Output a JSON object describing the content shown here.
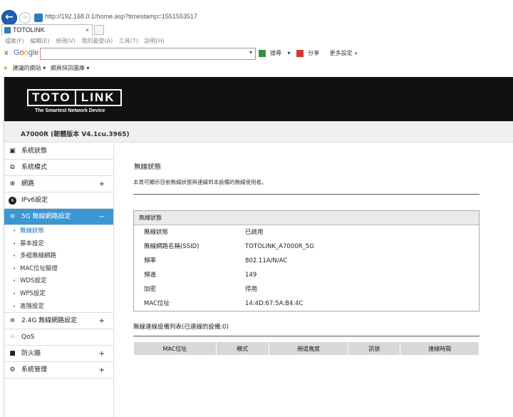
{
  "browser": {
    "url": "http://192.168.0.1/home.asp?timestamp=1551553517",
    "tab_title": "TOTOLINK",
    "tab_close": "×",
    "back": "←",
    "forward": "→"
  },
  "menu": [
    "檔案(F)",
    "編輯(E)",
    "檢視(V)",
    "我的最愛(A)",
    "工具(T)",
    "說明(H)"
  ],
  "google_toolbar": {
    "close": "x",
    "logo": "Google",
    "search_label": "搜尋",
    "share_label": "分享",
    "more_label": "更多設定 »"
  },
  "favorites": {
    "item1": "建議的網站 ▾",
    "item2": "網頁快訊圖庫 ▾"
  },
  "router": {
    "logo_left": "TOTO",
    "logo_right": "LINK",
    "tagline": "The Smartest Network Device",
    "model": "A7000R (韌體版本 V4.1cu.3965)"
  },
  "nav": [
    {
      "label": "系統狀態",
      "icon": "▣"
    },
    {
      "label": "系統模式",
      "icon": "⧉"
    },
    {
      "label": "網路",
      "icon": "⊕",
      "expand": "+"
    },
    {
      "label": "IPv6設定",
      "icon": "6"
    },
    {
      "label": "5G 無線網路設定",
      "icon": "≋",
      "expand": "−"
    },
    {
      "label": "2.4G 無線網路設定",
      "icon": "≋",
      "expand": "+"
    },
    {
      "label": "QoS",
      "icon": "⁘"
    },
    {
      "label": "防火牆",
      "icon": "■",
      "expand": "+"
    },
    {
      "label": "系統管理",
      "icon": "⚙",
      "expand": "+"
    }
  ],
  "subnav": [
    "無線狀態",
    "基本設定",
    "多組無線網路",
    "MAC位址驗證",
    "WDS設定",
    "WPS設定",
    "進階設定"
  ],
  "content": {
    "title": "無線狀態",
    "description": "本頁可顯示目前無線狀態與連線到本設備的無線使用者。",
    "status_header": "無線狀態",
    "rows": [
      {
        "key": "無線狀態",
        "value": "已啟用"
      },
      {
        "key": "無線網路名稱(SSID)",
        "value": "TOTOLINK_A7000R_5G"
      },
      {
        "key": "頻率",
        "value": "802.11A/N/AC"
      },
      {
        "key": "頻道",
        "value": "149"
      },
      {
        "key": "加密",
        "value": "停用"
      },
      {
        "key": "MAC位址",
        "value": "14:4D:67:5A:B4:4C"
      }
    ],
    "client_title": "無線連線設備列表(已連線的設備:0)",
    "client_columns": [
      "MAC位址",
      "模式",
      "頻道寬度",
      "訊號",
      "連線時間"
    ]
  }
}
